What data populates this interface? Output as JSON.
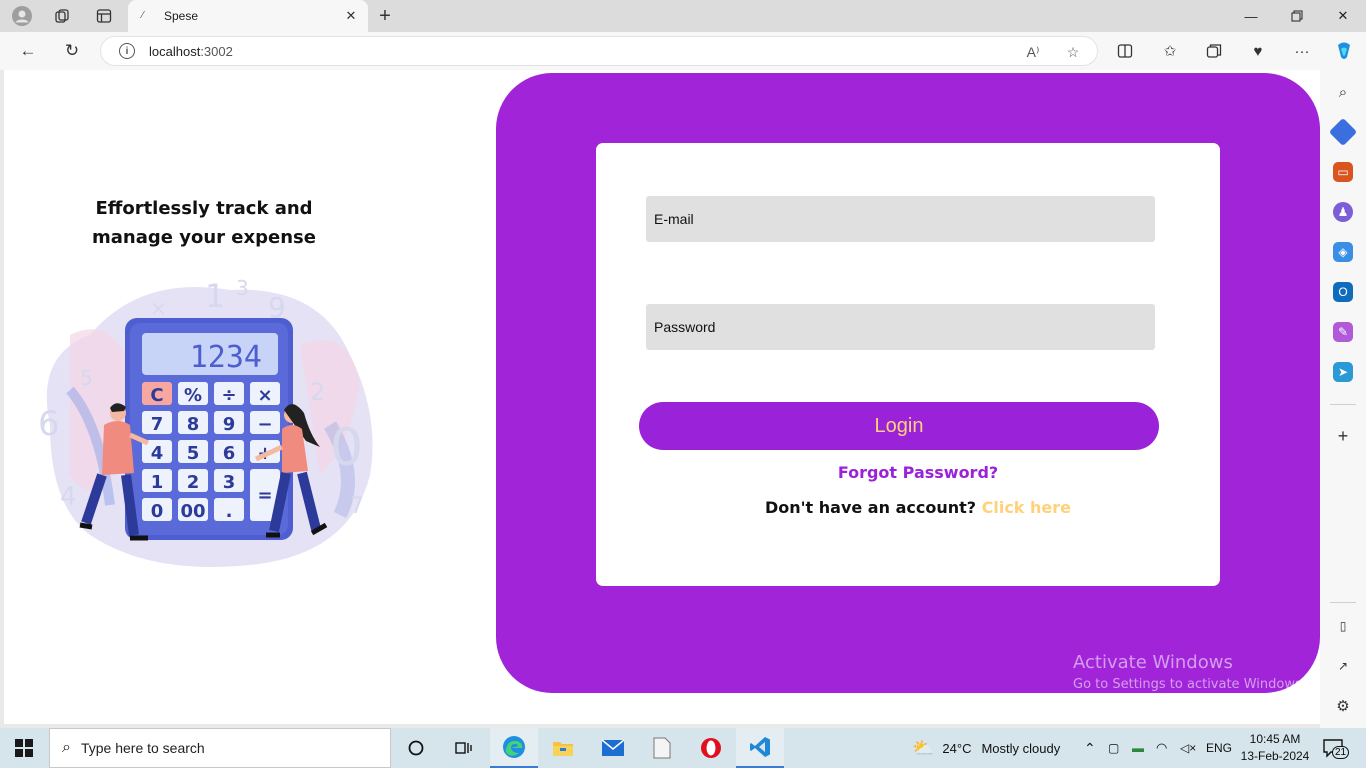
{
  "browser": {
    "tab_title": "Spese",
    "url_host": "localhost",
    "url_port": ":3002"
  },
  "page": {
    "tagline": "Effortlessly track and manage your expense",
    "calculator_display": "1234",
    "email_placeholder": "E-mail",
    "password_placeholder": "Password",
    "login_label": "Login",
    "forgot_label": "Forgot Password?",
    "signup_text": "Don't have an account?",
    "signup_link": "Click here",
    "colors": {
      "primary": "#a124d9",
      "accent": "#ffd17a"
    }
  },
  "watermark": {
    "line1": "Activate Windows",
    "line2": "Go to Settings to activate Windows."
  },
  "taskbar": {
    "search_placeholder": "Type here to search",
    "weather_temp": "24°C",
    "weather_desc": "Mostly cloudy",
    "language": "ENG",
    "time": "10:45 AM",
    "date": "13-Feb-2024",
    "notification_count": "21"
  }
}
